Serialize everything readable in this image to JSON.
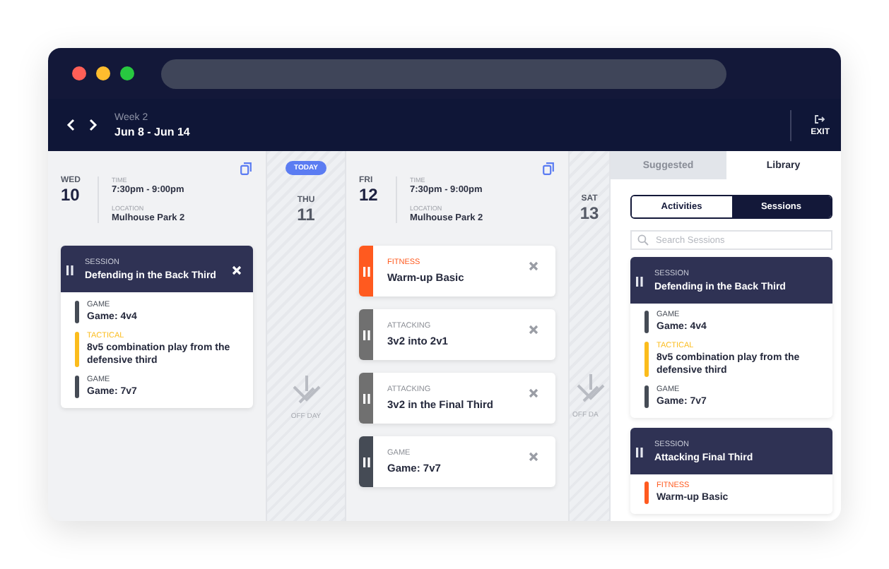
{
  "header": {
    "week": "Week 2",
    "range": "Jun 8 - Jun 14",
    "exit": "EXIT"
  },
  "days": [
    {
      "kind": "session",
      "weekday": "WED",
      "date": "10",
      "time_label": "TIME",
      "time": "7:30pm - 9:00pm",
      "location_label": "LOCATION",
      "location": "Mulhouse Park 2",
      "session": {
        "label": "SESSION",
        "title": "Defending in the Back Third",
        "items": [
          {
            "category": "GAME",
            "title": "Game: 4v4",
            "color": "#454b55"
          },
          {
            "category": "TACTICAL",
            "title": "8v5 combination play from the defensive third",
            "color": "#fbbc1c"
          },
          {
            "category": "GAME",
            "title": "Game: 7v7",
            "color": "#454b55"
          }
        ]
      }
    },
    {
      "kind": "off",
      "weekday": "THU",
      "date": "11",
      "badge": "TODAY",
      "off_label": "OFF DAY"
    },
    {
      "kind": "activities",
      "weekday": "FRI",
      "date": "12",
      "time_label": "TIME",
      "time": "7:30pm - 9:00pm",
      "location_label": "LOCATION",
      "location": "Mulhouse Park 2",
      "activities": [
        {
          "category": "FITNESS",
          "title": "Warm-up Basic",
          "color": "#ff5a1f"
        },
        {
          "category": "ATTACKING",
          "title": "3v2 into 2v1",
          "color": "#707070"
        },
        {
          "category": "ATTACKING",
          "title": "3v2 in the Final Third",
          "color": "#707070"
        },
        {
          "category": "GAME",
          "title": "Game: 7v7",
          "color": "#454b55"
        }
      ]
    },
    {
      "kind": "off",
      "weekday": "SAT",
      "date": "13",
      "off_label": "OFF DA"
    }
  ],
  "panel": {
    "tabs": [
      {
        "label": "Suggested",
        "selected": false
      },
      {
        "label": "Library",
        "selected": true
      }
    ],
    "toggle": [
      {
        "label": "Activities",
        "selected": false
      },
      {
        "label": "Sessions",
        "selected": true
      }
    ],
    "search": {
      "placeholder": "Search Sessions"
    },
    "sessions": [
      {
        "label": "SESSION",
        "title": "Defending in the Back Third",
        "items": [
          {
            "category": "GAME",
            "title": "Game: 4v4",
            "color": "#454b55"
          },
          {
            "category": "TACTICAL",
            "title": "8v5 combination play from the defensive third",
            "color": "#fbbc1c"
          },
          {
            "category": "GAME",
            "title": "Game: 7v7",
            "color": "#454b55"
          }
        ]
      },
      {
        "label": "SESSION",
        "title": "Attacking Final Third",
        "items": [
          {
            "category": "FITNESS",
            "title": "Warm-up Basic",
            "color": "#ff5a1f"
          }
        ]
      }
    ]
  }
}
